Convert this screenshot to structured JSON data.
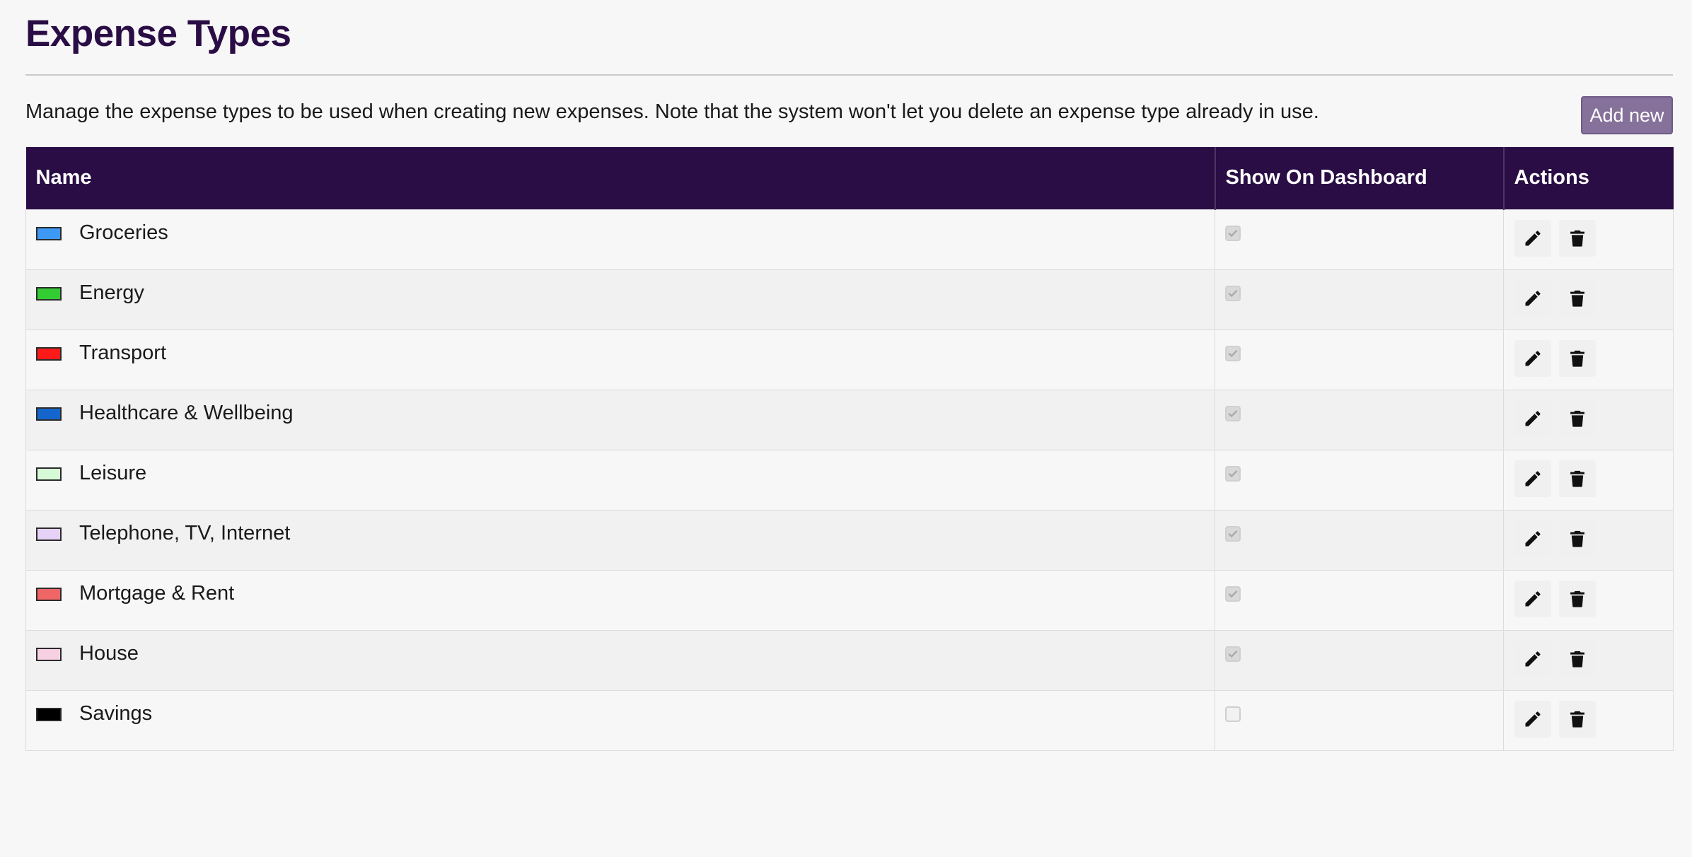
{
  "header": {
    "title": "Expense Types",
    "description": "Manage the expense types to be used when creating new expenses. Note that the system won't let you delete an expense type already in use.",
    "add_label": "Add new"
  },
  "table": {
    "columns": [
      "Name",
      "Show On Dashboard",
      "Actions"
    ],
    "rows": [
      {
        "name": "Groceries",
        "color": "#3d99f5",
        "show_on_dashboard": true
      },
      {
        "name": "Energy",
        "color": "#33cc33",
        "show_on_dashboard": true
      },
      {
        "name": "Transport",
        "color": "#ff1a1a",
        "show_on_dashboard": true
      },
      {
        "name": "Healthcare & Wellbeing",
        "color": "#1466cc",
        "show_on_dashboard": true
      },
      {
        "name": "Leisure",
        "color": "#d6fad6",
        "show_on_dashboard": true
      },
      {
        "name": "Telephone, TV, Internet",
        "color": "#e6d1f7",
        "show_on_dashboard": true
      },
      {
        "name": "Mortgage & Rent",
        "color": "#f06666",
        "show_on_dashboard": true
      },
      {
        "name": "House",
        "color": "#f7d1e3",
        "show_on_dashboard": true
      },
      {
        "name": "Savings",
        "color": "#000000",
        "show_on_dashboard": false
      }
    ]
  },
  "icons": {
    "edit": "pencil-icon",
    "delete": "trash-icon"
  },
  "colors": {
    "accent": "#2a0d45",
    "add_button": "#85719a",
    "background": "#f7f7f7"
  }
}
